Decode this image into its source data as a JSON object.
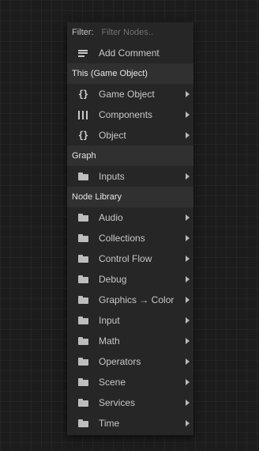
{
  "filter": {
    "label": "Filter:",
    "placeholder": "Filter Nodes.."
  },
  "add_comment": {
    "label": "Add Comment",
    "icon": "lines-icon"
  },
  "sections": {
    "this_object": {
      "title": "This (Game Object)",
      "items": [
        {
          "label": "Game Object",
          "icon": "braces-icon"
        },
        {
          "label": "Components",
          "icon": "bars-icon"
        },
        {
          "label": "Object",
          "icon": "braces-icon"
        }
      ]
    },
    "graph": {
      "title": "Graph",
      "items": [
        {
          "label": "Inputs",
          "icon": "folder-icon"
        }
      ]
    },
    "node_library": {
      "title": "Node Library",
      "items": [
        {
          "label": "Audio",
          "icon": "folder-icon"
        },
        {
          "label": "Collections",
          "icon": "folder-icon"
        },
        {
          "label": "Control Flow",
          "icon": "folder-icon"
        },
        {
          "label": "Debug",
          "icon": "folder-icon"
        },
        {
          "label": "Graphics → Color",
          "icon": "folder-icon"
        },
        {
          "label": "Input",
          "icon": "folder-icon"
        },
        {
          "label": "Math",
          "icon": "folder-icon"
        },
        {
          "label": "Operators",
          "icon": "folder-icon"
        },
        {
          "label": "Scene",
          "icon": "folder-icon"
        },
        {
          "label": "Services",
          "icon": "folder-icon"
        },
        {
          "label": "Time",
          "icon": "folder-icon"
        }
      ]
    }
  }
}
